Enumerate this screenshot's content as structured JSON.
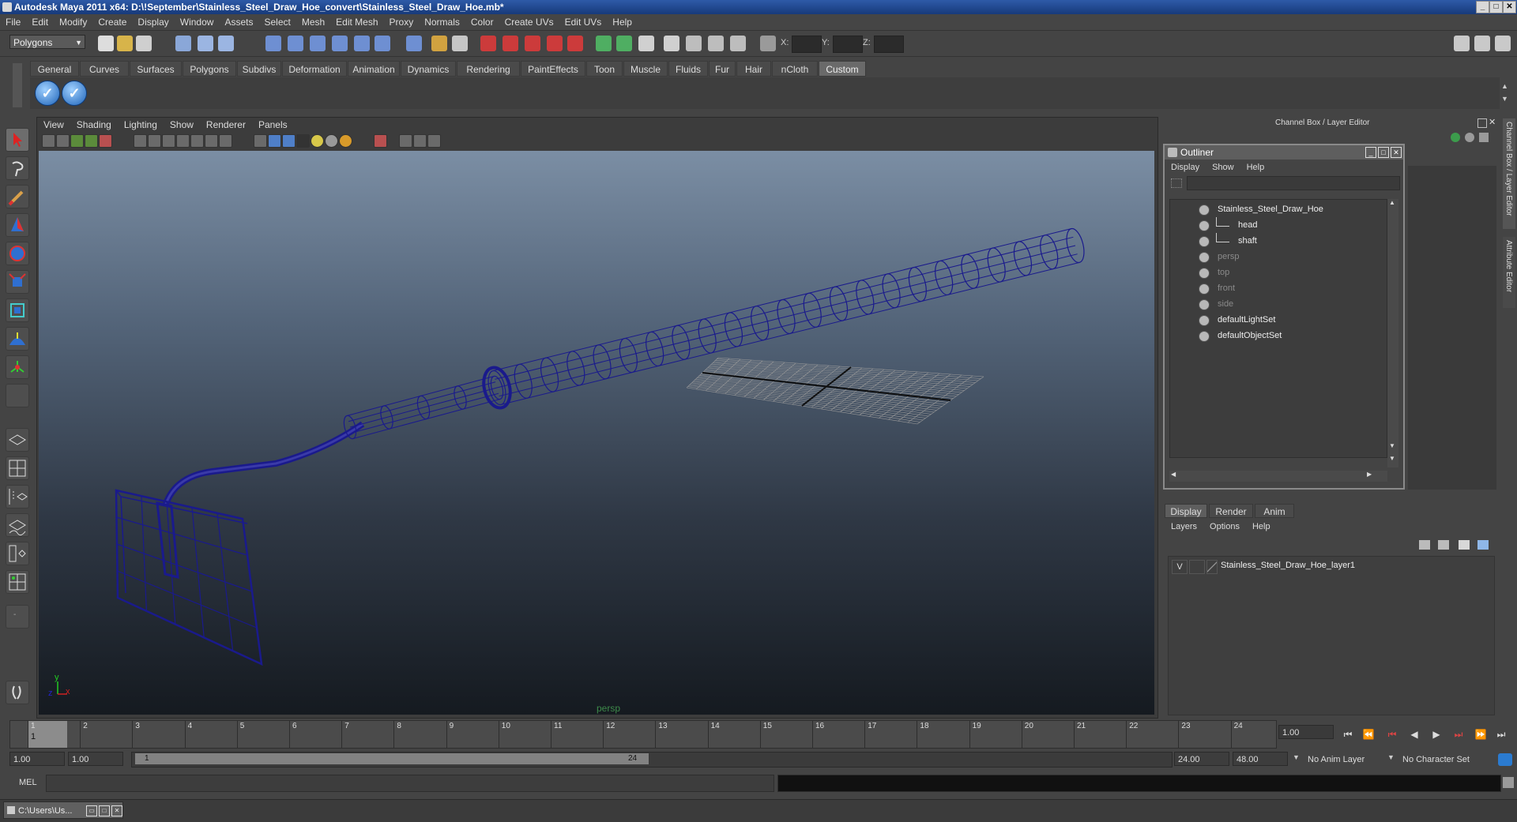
{
  "window": {
    "title": "Autodesk Maya 2011 x64: D:\\!September\\Stainless_Steel_Draw_Hoe_convert\\Stainless_Steel_Draw_Hoe.mb*"
  },
  "menubar": [
    "File",
    "Edit",
    "Modify",
    "Create",
    "Display",
    "Window",
    "Assets",
    "Select",
    "Mesh",
    "Edit Mesh",
    "Proxy",
    "Normals",
    "Color",
    "Create UVs",
    "Edit UVs",
    "Help"
  ],
  "statusline": {
    "mode": "Polygons",
    "x_label": "X:",
    "y_label": "Y:",
    "z_label": "Z:"
  },
  "shelf_tabs": [
    "General",
    "Curves",
    "Surfaces",
    "Polygons",
    "Subdivs",
    "Deformation",
    "Animation",
    "Dynamics",
    "Rendering",
    "PaintEffects",
    "Toon",
    "Muscle",
    "Fluids",
    "Fur",
    "Hair",
    "nCloth",
    "Custom"
  ],
  "active_shelf_tab": "Custom",
  "viewport": {
    "menu": [
      "View",
      "Shading",
      "Lighting",
      "Show",
      "Renderer",
      "Panels"
    ],
    "camera_label": "persp",
    "axis_x": "x",
    "axis_y": "y",
    "axis_z": "z"
  },
  "channel_box_header": "Channel Box / Layer Editor",
  "side_tabs": {
    "channel": "Channel Box / Layer Editor",
    "attribute": "Attribute Editor"
  },
  "outliner": {
    "title": "Outliner",
    "menu": [
      "Display",
      "Show",
      "Help"
    ],
    "items": [
      {
        "label": "Stainless_Steel_Draw_Hoe",
        "depth": 0,
        "dim": false
      },
      {
        "label": "head",
        "depth": 1,
        "dim": false
      },
      {
        "label": "shaft",
        "depth": 1,
        "dim": false
      },
      {
        "label": "persp",
        "depth": 0,
        "dim": true
      },
      {
        "label": "top",
        "depth": 0,
        "dim": true
      },
      {
        "label": "front",
        "depth": 0,
        "dim": true
      },
      {
        "label": "side",
        "depth": 0,
        "dim": true
      },
      {
        "label": "defaultLightSet",
        "depth": 0,
        "dim": false
      },
      {
        "label": "defaultObjectSet",
        "depth": 0,
        "dim": false
      }
    ]
  },
  "layer_editor": {
    "tabs": [
      "Display",
      "Render",
      "Anim"
    ],
    "active_tab": "Display",
    "menu": [
      "Layers",
      "Options",
      "Help"
    ],
    "layers": [
      {
        "visible": "V",
        "name": "Stainless_Steel_Draw_Hoe_layer1"
      }
    ]
  },
  "timeline": {
    "ticks": [
      "1",
      "2",
      "3",
      "4",
      "5",
      "6",
      "7",
      "8",
      "9",
      "10",
      "11",
      "12",
      "13",
      "14",
      "15",
      "16",
      "17",
      "18",
      "19",
      "20",
      "21",
      "22",
      "23",
      "24"
    ],
    "current_frame": "1",
    "current_time_field": "1.00"
  },
  "range": {
    "start_time": "1.00",
    "playback_start": "1.00",
    "range_start_label": "1",
    "range_end_label": "24",
    "playback_end": "24.00",
    "end_time": "48.00",
    "anim_layer": "No Anim Layer",
    "character_set": "No Character Set"
  },
  "command_line": {
    "label": "MEL"
  },
  "taskbar": {
    "item": "C:\\Users\\Us..."
  },
  "colors": {
    "wireframe": "#1a1a8c",
    "grid": "#9a9a9a",
    "title_bar": "#2e5aa8"
  }
}
